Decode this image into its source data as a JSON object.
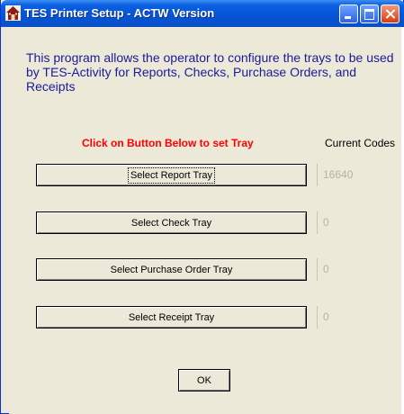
{
  "window": {
    "title": "TES Printer Setup  - ACTW Version",
    "controls": [
      "minimize-icon",
      "maximize-icon",
      "close-icon"
    ]
  },
  "description": "This program allows the operator to configure the trays to be used by TES-Activity for Reports, Checks, Purchase Orders, and Receipts",
  "instruction_label": "Click on Button Below to set Tray",
  "current_codes_label": "Current Codes",
  "trays": [
    {
      "button_label": "Select Report Tray",
      "code": "16640"
    },
    {
      "button_label": "Select Check Tray",
      "code": "0"
    },
    {
      "button_label": "Select Purchase Order Tray",
      "code": "0"
    },
    {
      "button_label": "Select Receipt Tray",
      "code": "0"
    }
  ],
  "ok_label": "OK",
  "colors": {
    "title_bar": "#0a5fe0",
    "description_text": "#1a1a9a",
    "instruction_text": "#ff0000",
    "code_text": "#b5b3a8",
    "window_bg": "#ece9d8"
  }
}
